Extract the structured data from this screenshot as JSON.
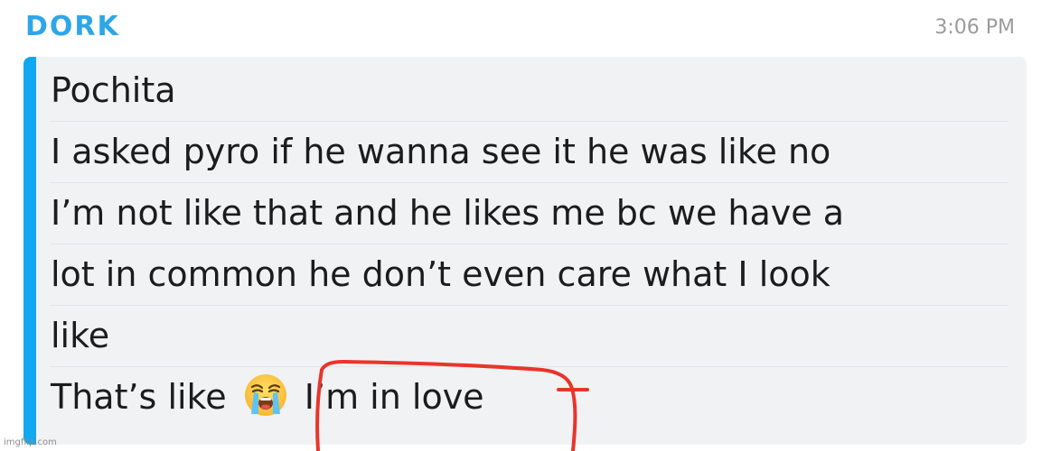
{
  "header": {
    "sender": "DORK",
    "time": "3:06 PM"
  },
  "message": {
    "lines": [
      "Pochita",
      "I asked pyro if he wanna see it he was like no",
      "I’m not like that and he likes me bc we have a",
      "lot in common he don’t even care what I look",
      "like"
    ],
    "last_line_prefix": "That’s like",
    "emoji": "loudly-crying-face-icon",
    "last_line_suffix": "I’m in love"
  },
  "colors": {
    "sender": "#2ea6e8",
    "accent": "#11a8f1",
    "card": "#f1f2f4",
    "annotation": "#e8352c"
  },
  "watermark": "imgflip.com"
}
